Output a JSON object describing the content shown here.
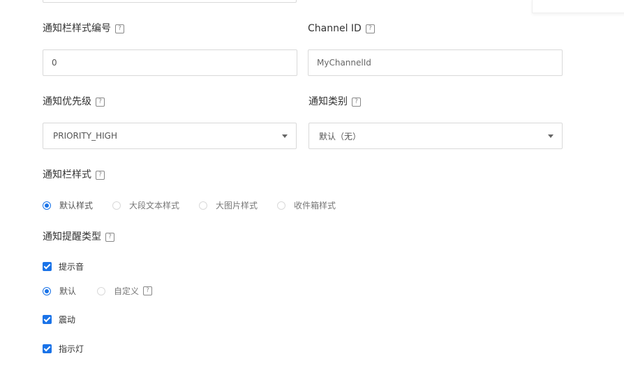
{
  "style_number": {
    "label": "通知栏样式编号",
    "value": "0"
  },
  "channel_id": {
    "label": "Channel ID",
    "placeholder": "MyChannelId"
  },
  "priority": {
    "label": "通知优先级",
    "selected": "PRIORITY_HIGH"
  },
  "category": {
    "label": "通知类别",
    "selected": "默认（无）"
  },
  "bar_style": {
    "label": "通知栏样式",
    "options": [
      "默认样式",
      "大段文本样式",
      "大图片样式",
      "收件箱样式"
    ],
    "selected_index": 0
  },
  "reminder_type": {
    "label": "通知提醒类型",
    "sound_label": "提示音",
    "sound_options": [
      "默认",
      "自定义"
    ],
    "sound_selected_index": 0,
    "vibrate_label": "震动",
    "light_label": "指示灯"
  },
  "help_glyph": "?",
  "colors": {
    "accent": "#1a73e8",
    "border": "#d9d9d9",
    "text": "#333333"
  }
}
